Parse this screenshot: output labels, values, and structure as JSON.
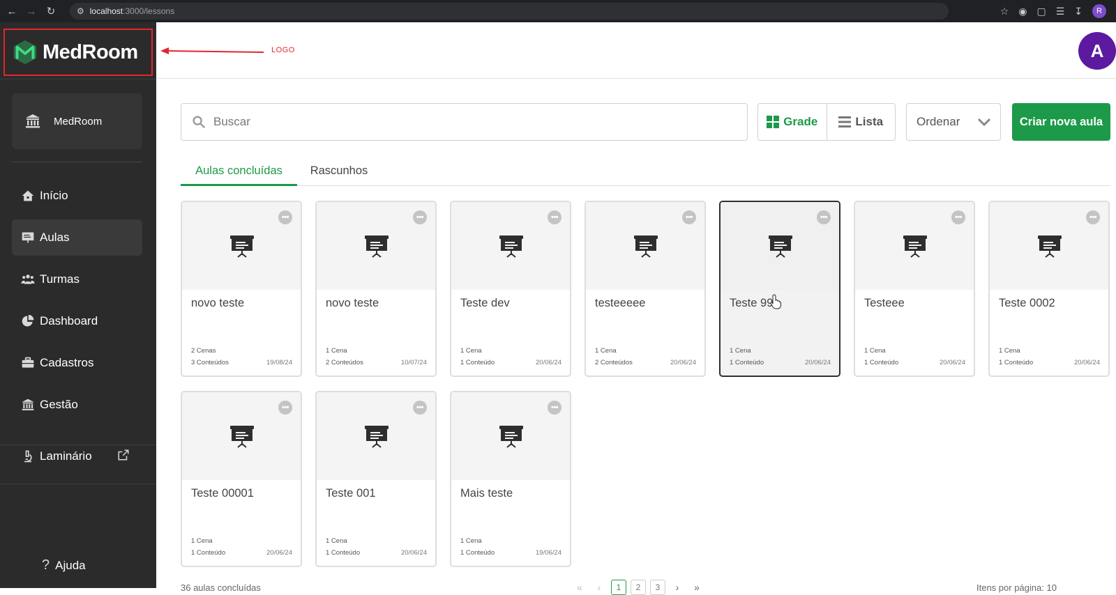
{
  "browser": {
    "url_host": "localhost",
    "url_path": ":3000/lessons",
    "profile_initial": "R"
  },
  "sidebar": {
    "logo_text": "MedRoom",
    "org_name": "MedRoom",
    "items": [
      {
        "label": "Início",
        "icon": "home-icon"
      },
      {
        "label": "Aulas",
        "icon": "lesson-board-icon",
        "active": true
      },
      {
        "label": "Turmas",
        "icon": "users-icon"
      },
      {
        "label": "Dashboard",
        "icon": "pie-chart-icon"
      },
      {
        "label": "Cadastros",
        "icon": "briefcase-icon"
      },
      {
        "label": "Gestão",
        "icon": "bank-icon"
      }
    ],
    "laminario_label": "Laminário",
    "help_label": "Ajuda"
  },
  "annotation": {
    "label": "LOGO",
    "color": "#e3262e"
  },
  "header": {
    "avatar_initial": "A",
    "avatar_color": "#5b1aa0"
  },
  "toolbar": {
    "search_placeholder": "Buscar",
    "grid_label": "Grade",
    "list_label": "Lista",
    "sort_label": "Ordenar",
    "create_label": "Criar nova aula",
    "accent_color": "#1c9a49"
  },
  "tabs": [
    {
      "label": "Aulas concluídas",
      "active": true
    },
    {
      "label": "Rascunhos",
      "active": false
    }
  ],
  "lessons": [
    {
      "title": "novo teste",
      "scenes": "2 Cenas",
      "contents": "3 Conteúdos",
      "date": "19/08/24"
    },
    {
      "title": "novo teste",
      "scenes": "1 Cena",
      "contents": "2 Conteúdos",
      "date": "10/07/24"
    },
    {
      "title": "Teste dev",
      "scenes": "1 Cena",
      "contents": "1 Conteúdo",
      "date": "20/06/24"
    },
    {
      "title": "testeeeee",
      "scenes": "1 Cena",
      "contents": "2 Conteúdos",
      "date": "20/06/24"
    },
    {
      "title": "Teste 99",
      "scenes": "1 Cena",
      "contents": "1 Conteúdo",
      "date": "20/06/24",
      "hovered": true
    },
    {
      "title": "Testeee",
      "scenes": "1 Cena",
      "contents": "1 Conteúdo",
      "date": "20/06/24"
    },
    {
      "title": "Teste 0002",
      "scenes": "1 Cena",
      "contents": "1 Conteúdo",
      "date": "20/06/24"
    },
    {
      "title": "Teste 00001",
      "scenes": "1 Cena",
      "contents": "1 Conteúdo",
      "date": "20/06/24"
    },
    {
      "title": "Teste 001",
      "scenes": "1 Cena",
      "contents": "1 Conteúdo",
      "date": "20/06/24"
    },
    {
      "title": "Mais teste",
      "scenes": "1 Cena",
      "contents": "1 Conteúdo",
      "date": "19/06/24"
    }
  ],
  "footer": {
    "count_text": "36 aulas concluídas",
    "pages": [
      "1",
      "2",
      "3"
    ],
    "current_page": "1",
    "per_page_text": "Itens por página: 10"
  }
}
